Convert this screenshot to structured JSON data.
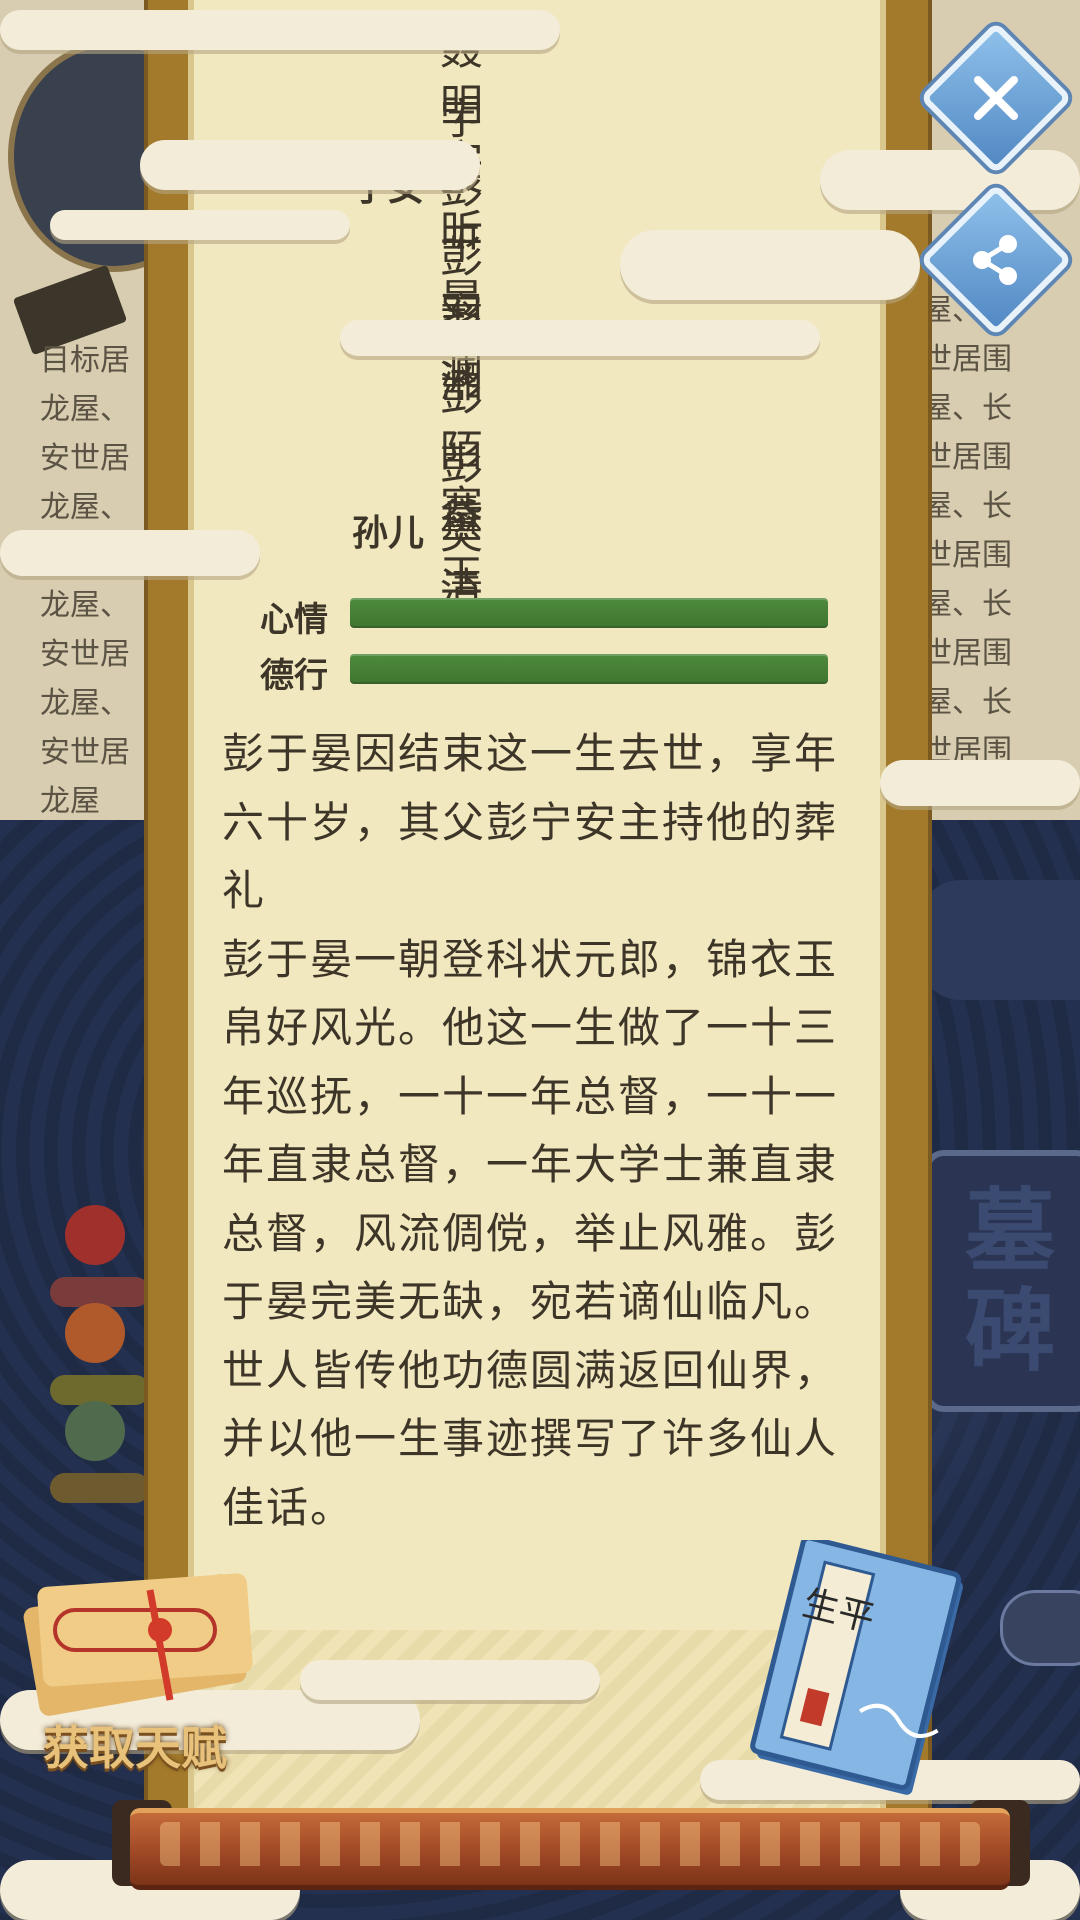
{
  "background": {
    "left_column": "目标居\n龙屋、\n安世居\n龙屋、\n\n龙屋、\n安世居\n龙屋、\n安世居\n龙屋",
    "right_column": "屋、长\n世居围\n屋、长\n世居围\n屋、长\n世居围\n屋、长\n世居围\n屋、长\n世居围",
    "wall_sign_top": "墓",
    "wall_sign_bottom": "碑"
  },
  "family": {
    "rows": [
      {
        "relation": "",
        "name": "聂明空"
      },
      {
        "relation": "",
        "name": "宇文昕"
      },
      {
        "relation": "子女",
        "name": "彭于晏"
      },
      {
        "relation": "",
        "name": "彭羽澜"
      },
      {
        "relation": "",
        "name": "彭湘"
      },
      {
        "relation": "",
        "name": "彭陌寒"
      },
      {
        "relation": "",
        "name": "彭黛玉"
      },
      {
        "relation": "孙儿",
        "name": "樊清"
      }
    ]
  },
  "stats": {
    "mood_label": "心情",
    "mood_value": 1.0,
    "virtue_label": "德行",
    "virtue_value": 1.0
  },
  "biography": {
    "paragraph_1": "彭于晏因结束这一生去世，享年六十岁，其父彭宁安主持他的葬礼",
    "paragraph_2": "彭于晏一朝登科状元郎，锦衣玉帛好风光。他这一生做了一十三年巡抚，一十一年总督，一十一年直隶总督，一年大学士兼直隶总督，风流倜傥，举止风雅。彭于晏完美无缺，宛若谪仙临凡。世人皆传他功德圆满返回仙界，并以他一生事迹撰写了许多仙人佳话。"
  },
  "buttons": {
    "close_icon": "close-icon",
    "share_icon": "share-icon",
    "talent_label": "获取天赋",
    "lifebook_title": "生平",
    "lifebook_seal": "印"
  },
  "colors": {
    "paper": "#f2e8c0",
    "text": "#3d3628",
    "bar_green": "#4e8a3c",
    "button_blue": "#5289c4",
    "talent_gold": "#e8c27a"
  }
}
